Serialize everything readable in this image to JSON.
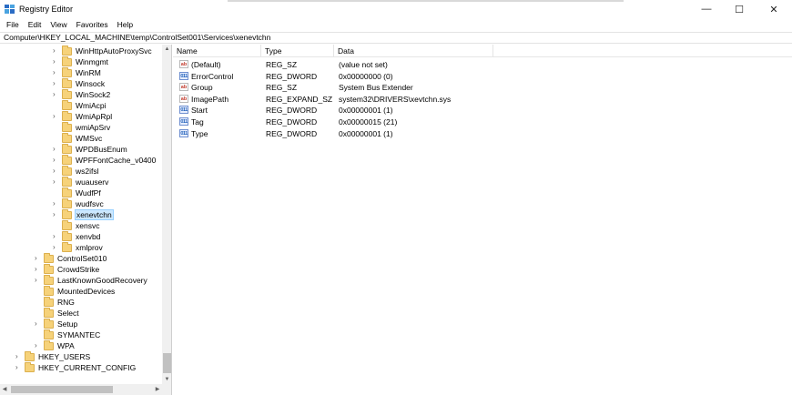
{
  "window": {
    "title": "Registry Editor",
    "minimize_glyph": "—",
    "maximize_glyph": "☐",
    "close_glyph": "✕"
  },
  "menu": [
    "File",
    "Edit",
    "View",
    "Favorites",
    "Help"
  ],
  "address": "Computer\\HKEY_LOCAL_MACHINE\\temp\\ControlSet001\\Services\\xenevtchn",
  "tree": [
    {
      "label": "WinHttpAutoProxySvc",
      "level": 3,
      "expander": true
    },
    {
      "label": "Winmgmt",
      "level": 3,
      "expander": true
    },
    {
      "label": "WinRM",
      "level": 3,
      "expander": true
    },
    {
      "label": "Winsock",
      "level": 3,
      "expander": true
    },
    {
      "label": "WinSock2",
      "level": 3,
      "expander": true
    },
    {
      "label": "WmiAcpi",
      "level": 3,
      "expander": false
    },
    {
      "label": "WmiApRpl",
      "level": 3,
      "expander": true
    },
    {
      "label": "wmiApSrv",
      "level": 3,
      "expander": false
    },
    {
      "label": "WMSvc",
      "level": 3,
      "expander": false
    },
    {
      "label": "WPDBusEnum",
      "level": 3,
      "expander": true
    },
    {
      "label": "WPFFontCache_v0400",
      "level": 3,
      "expander": true
    },
    {
      "label": "ws2ifsl",
      "level": 3,
      "expander": true
    },
    {
      "label": "wuauserv",
      "level": 3,
      "expander": true
    },
    {
      "label": "WudfPf",
      "level": 3,
      "expander": false
    },
    {
      "label": "wudfsvc",
      "level": 3,
      "expander": true
    },
    {
      "label": "xenevtchn",
      "level": 3,
      "expander": true,
      "selected": true
    },
    {
      "label": "xensvc",
      "level": 3,
      "expander": false
    },
    {
      "label": "xenvbd",
      "level": 3,
      "expander": true
    },
    {
      "label": "xmlprov",
      "level": 3,
      "expander": true
    },
    {
      "label": "ControlSet010",
      "level": 2,
      "expander": true
    },
    {
      "label": "CrowdStrike",
      "level": 2,
      "expander": true
    },
    {
      "label": "LastKnownGoodRecovery",
      "level": 2,
      "expander": true
    },
    {
      "label": "MountedDevices",
      "level": 2,
      "expander": false
    },
    {
      "label": "RNG",
      "level": 2,
      "expander": false
    },
    {
      "label": "Select",
      "level": 2,
      "expander": false
    },
    {
      "label": "Setup",
      "level": 2,
      "expander": true
    },
    {
      "label": "SYMANTEC",
      "level": 2,
      "expander": false
    },
    {
      "label": "WPA",
      "level": 2,
      "expander": true
    },
    {
      "label": "HKEY_USERS",
      "level": 1,
      "expander": true
    },
    {
      "label": "HKEY_CURRENT_CONFIG",
      "level": 1,
      "expander": true
    }
  ],
  "columns": {
    "name": "Name",
    "type": "Type",
    "data": "Data"
  },
  "values": [
    {
      "name": "(Default)",
      "type": "REG_SZ",
      "data": "(value not set)",
      "icon": "sz"
    },
    {
      "name": "ErrorControl",
      "type": "REG_DWORD",
      "data": "0x00000000 (0)",
      "icon": "dword"
    },
    {
      "name": "Group",
      "type": "REG_SZ",
      "data": "System Bus Extender",
      "icon": "sz"
    },
    {
      "name": "ImagePath",
      "type": "REG_EXPAND_SZ",
      "data": "system32\\DRIVERS\\xevtchn.sys",
      "icon": "sz"
    },
    {
      "name": "Start",
      "type": "REG_DWORD",
      "data": "0x00000001 (1)",
      "icon": "dword"
    },
    {
      "name": "Tag",
      "type": "REG_DWORD",
      "data": "0x00000015 (21)",
      "icon": "dword"
    },
    {
      "name": "Type",
      "type": "REG_DWORD",
      "data": "0x00000001 (1)",
      "icon": "dword"
    }
  ],
  "icon_glyphs": {
    "sz": "ab",
    "dword": "011"
  },
  "colors": {
    "selection": "#cce8ff",
    "folder": "#f6d27a"
  }
}
